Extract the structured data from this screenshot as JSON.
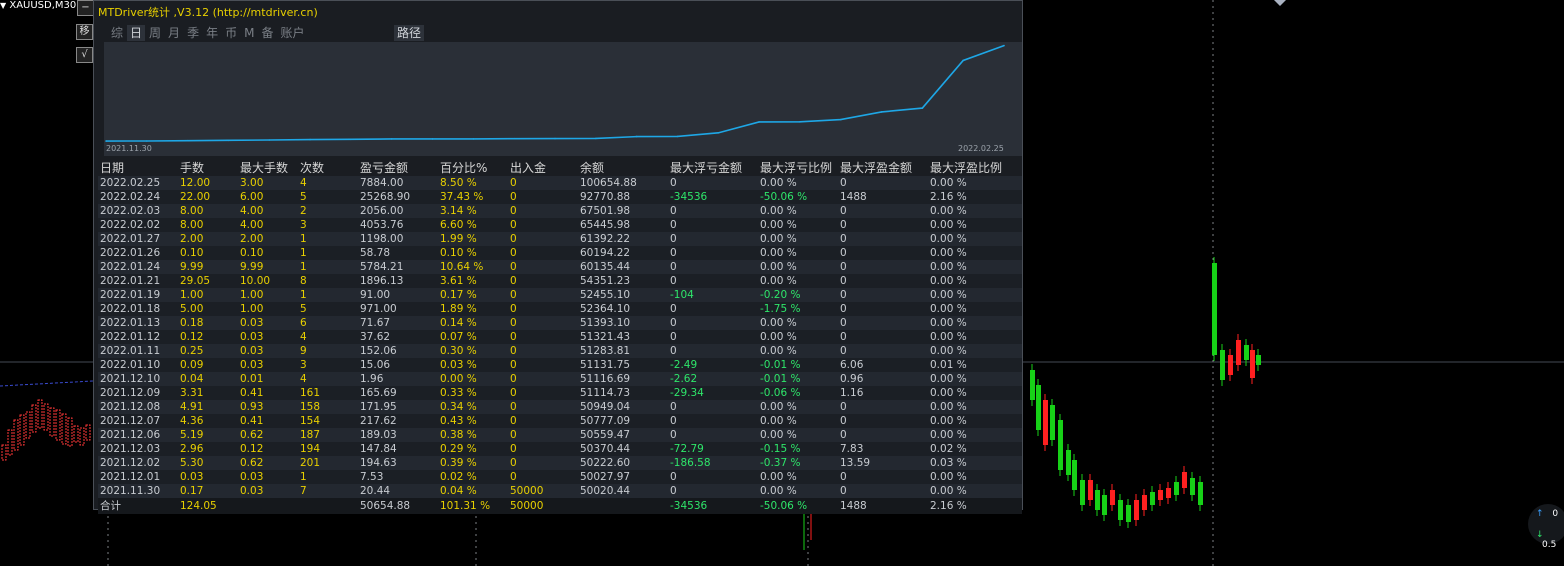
{
  "chart_window": {
    "symbol": "XAUUSD,M30",
    "side_buttons": [
      "移",
      "√"
    ],
    "right_indicators": [
      {
        "arrow": "↑",
        "text": "0"
      },
      {
        "arrow": "↓",
        "text": "0.5"
      }
    ]
  },
  "panel": {
    "title": "MTDriver统计 ,V3.12 (http://mtdriver.cn)",
    "tabs": [
      "综",
      "日",
      "周",
      "月",
      "季",
      "年",
      "币",
      "M",
      "备",
      "账户"
    ],
    "selected_tab": "日",
    "path_button": "路径",
    "chart_start_label": "2021.11.30",
    "chart_end_label": "2022.02.25"
  },
  "chart_data": {
    "type": "line",
    "x": [
      "2021.11.30",
      "2021.12.01",
      "2021.12.02",
      "2021.12.03",
      "2021.12.06",
      "2021.12.07",
      "2021.12.08",
      "2021.12.09",
      "2021.12.10",
      "2022.01.10",
      "2022.01.11",
      "2022.01.12",
      "2022.01.13",
      "2022.01.18",
      "2022.01.19",
      "2022.01.21",
      "2022.01.24",
      "2022.01.26",
      "2022.01.27",
      "2022.02.02",
      "2022.02.03",
      "2022.02.24",
      "2022.02.25"
    ],
    "y": [
      50020.44,
      50027.97,
      50222.6,
      50370.44,
      50559.47,
      50777.09,
      50949.04,
      51114.73,
      51116.69,
      51131.75,
      51283.81,
      51321.43,
      51393.1,
      52364.1,
      52455.1,
      54351.23,
      60135.44,
      60194.22,
      61392.22,
      65445.98,
      67501.98,
      92770.88,
      100654.88
    ],
    "ylim": [
      49500,
      101500
    ],
    "color": "#1ea7e6"
  },
  "table": {
    "headers": [
      "日期",
      "手数",
      "最大手数",
      "次数",
      "盈亏金额",
      "百分比%",
      "出入金",
      "余额",
      "最大浮亏金额",
      "最大浮亏比例",
      "最大浮盈金额",
      "最大浮盈比例"
    ],
    "rows": [
      [
        "2022.02.25",
        "12.00",
        "3.00",
        "4",
        "7884.00",
        "8.50 %",
        "0",
        "100654.88",
        "0",
        "0.00 %",
        "0",
        "0.00 %"
      ],
      [
        "2022.02.24",
        "22.00",
        "6.00",
        "5",
        "25268.90",
        "37.43 %",
        "0",
        "92770.88",
        "-34536",
        "-50.06 %",
        "1488",
        "2.16 %"
      ],
      [
        "2022.02.03",
        "8.00",
        "4.00",
        "2",
        "2056.00",
        "3.14 %",
        "0",
        "67501.98",
        "0",
        "0.00 %",
        "0",
        "0.00 %"
      ],
      [
        "2022.02.02",
        "8.00",
        "4.00",
        "3",
        "4053.76",
        "6.60 %",
        "0",
        "65445.98",
        "0",
        "0.00 %",
        "0",
        "0.00 %"
      ],
      [
        "2022.01.27",
        "2.00",
        "2.00",
        "1",
        "1198.00",
        "1.99 %",
        "0",
        "61392.22",
        "0",
        "0.00 %",
        "0",
        "0.00 %"
      ],
      [
        "2022.01.26",
        "0.10",
        "0.10",
        "1",
        "58.78",
        "0.10 %",
        "0",
        "60194.22",
        "0",
        "0.00 %",
        "0",
        "0.00 %"
      ],
      [
        "2022.01.24",
        "9.99",
        "9.99",
        "1",
        "5784.21",
        "10.64 %",
        "0",
        "60135.44",
        "0",
        "0.00 %",
        "0",
        "0.00 %"
      ],
      [
        "2022.01.21",
        "29.05",
        "10.00",
        "8",
        "1896.13",
        "3.61 %",
        "0",
        "54351.23",
        "0",
        "0.00 %",
        "0",
        "0.00 %"
      ],
      [
        "2022.01.19",
        "1.00",
        "1.00",
        "1",
        "91.00",
        "0.17 %",
        "0",
        "52455.10",
        "-104",
        "-0.20 %",
        "0",
        "0.00 %"
      ],
      [
        "2022.01.18",
        "5.00",
        "1.00",
        "5",
        "971.00",
        "1.89 %",
        "0",
        "52364.10",
        "0",
        "-1.75 %",
        "0",
        "0.00 %"
      ],
      [
        "2022.01.13",
        "0.18",
        "0.03",
        "6",
        "71.67",
        "0.14 %",
        "0",
        "51393.10",
        "0",
        "0.00 %",
        "0",
        "0.00 %"
      ],
      [
        "2022.01.12",
        "0.12",
        "0.03",
        "4",
        "37.62",
        "0.07 %",
        "0",
        "51321.43",
        "0",
        "0.00 %",
        "0",
        "0.00 %"
      ],
      [
        "2022.01.11",
        "0.25",
        "0.03",
        "9",
        "152.06",
        "0.30 %",
        "0",
        "51283.81",
        "0",
        "0.00 %",
        "0",
        "0.00 %"
      ],
      [
        "2022.01.10",
        "0.09",
        "0.03",
        "3",
        "15.06",
        "0.03 %",
        "0",
        "51131.75",
        "-2.49",
        "-0.01 %",
        "6.06",
        "0.01 %"
      ],
      [
        "2021.12.10",
        "0.04",
        "0.01",
        "4",
        "1.96",
        "0.00 %",
        "0",
        "51116.69",
        "-2.62",
        "-0.01 %",
        "0.96",
        "0.00 %"
      ],
      [
        "2021.12.09",
        "3.31",
        "0.41",
        "161",
        "165.69",
        "0.33 %",
        "0",
        "51114.73",
        "-29.34",
        "-0.06 %",
        "1.16",
        "0.00 %"
      ],
      [
        "2021.12.08",
        "4.91",
        "0.93",
        "158",
        "171.95",
        "0.34 %",
        "0",
        "50949.04",
        "0",
        "0.00 %",
        "0",
        "0.00 %"
      ],
      [
        "2021.12.07",
        "4.36",
        "0.41",
        "154",
        "217.62",
        "0.43 %",
        "0",
        "50777.09",
        "0",
        "0.00 %",
        "0",
        "0.00 %"
      ],
      [
        "2021.12.06",
        "5.19",
        "0.62",
        "187",
        "189.03",
        "0.38 %",
        "0",
        "50559.47",
        "0",
        "0.00 %",
        "0",
        "0.00 %"
      ],
      [
        "2021.12.03",
        "2.96",
        "0.12",
        "194",
        "147.84",
        "0.29 %",
        "0",
        "50370.44",
        "-72.79",
        "-0.15 %",
        "7.83",
        "0.02 %"
      ],
      [
        "2021.12.02",
        "5.30",
        "0.62",
        "201",
        "194.63",
        "0.39 %",
        "0",
        "50222.60",
        "-186.58",
        "-0.37 %",
        "13.59",
        "0.03 %"
      ],
      [
        "2021.12.01",
        "0.03",
        "0.03",
        "1",
        "7.53",
        "0.02 %",
        "0",
        "50027.97",
        "0",
        "0.00 %",
        "0",
        "0.00 %"
      ],
      [
        "2021.11.30",
        "0.17",
        "0.03",
        "7",
        "20.44",
        "0.04 %",
        "50000",
        "50020.44",
        "0",
        "0.00 %",
        "0",
        "0.00 %"
      ]
    ],
    "total": [
      "合计",
      "124.05",
      "",
      "",
      "50654.88",
      "101.31 %",
      "50000",
      "",
      "-34536",
      "-50.06 %",
      "1488",
      "2.16 %"
    ]
  }
}
